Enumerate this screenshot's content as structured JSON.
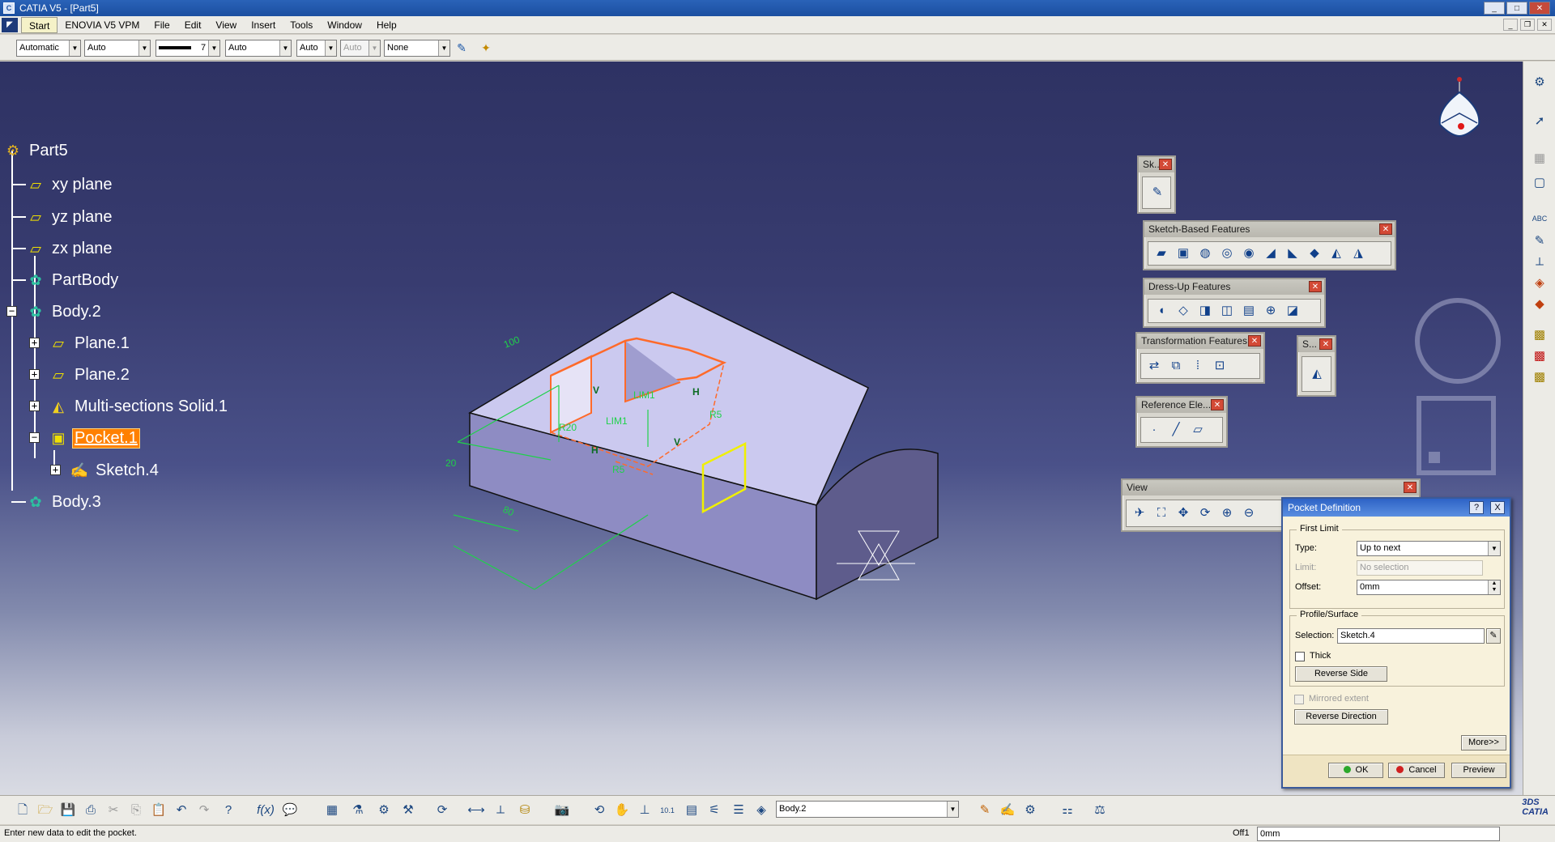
{
  "window": {
    "title": "CATIA V5 - [Part5]"
  },
  "menu": {
    "start": "Start",
    "items": [
      "ENOVIA V5 VPM",
      "File",
      "Edit",
      "View",
      "Insert",
      "Tools",
      "Window",
      "Help"
    ]
  },
  "graphic_properties": {
    "fill_color": "Automatic",
    "transparency": "Auto",
    "line_weight": "7",
    "line_type": "Auto",
    "point_symbol": "Auto",
    "render_style": "Auto",
    "layer": "None"
  },
  "tree": {
    "root": "Part5",
    "items": [
      {
        "label": "xy plane",
        "icon": "plane-icon"
      },
      {
        "label": "yz plane",
        "icon": "plane-icon"
      },
      {
        "label": "zx plane",
        "icon": "plane-icon"
      },
      {
        "label": "PartBody",
        "icon": "body-icon"
      },
      {
        "label": "Body.2",
        "icon": "body-icon"
      },
      {
        "label": "Plane.1",
        "icon": "plane-icon"
      },
      {
        "label": "Plane.2",
        "icon": "plane-icon"
      },
      {
        "label": "Multi-sections Solid.1",
        "icon": "multi-section-solid-icon"
      },
      {
        "label": "Pocket.1",
        "icon": "pocket-icon",
        "selected": true
      },
      {
        "label": "Sketch.4",
        "icon": "sketch-icon"
      },
      {
        "label": "Body.3",
        "icon": "body-icon"
      }
    ]
  },
  "sketch_annotations": {
    "dim_100": "100",
    "dim_20_left": "20",
    "dim_80": "80",
    "dim_r20": "R20",
    "dim_r5_a": "R5",
    "dim_r5_b": "R5",
    "lim1": "LIM1",
    "lim2": "LIM1",
    "h_a": "H",
    "h_b": "H",
    "v_a": "V",
    "v_b": "V"
  },
  "toolbars": {
    "sketcher": {
      "title": "Sk..."
    },
    "sketch_based": {
      "title": "Sketch-Based Features"
    },
    "dress_up": {
      "title": "Dress-Up Features"
    },
    "transformation": {
      "title": "Transformation Features"
    },
    "surface": {
      "title": "S..."
    },
    "reference": {
      "title": "Reference Ele..."
    },
    "view": {
      "title": "View"
    }
  },
  "pocket_dialog": {
    "title": "Pocket Definition",
    "help_btn": "?",
    "close_btn": "X",
    "first_limit": {
      "group": "First Limit",
      "type_label": "Type:",
      "type_value": "Up to next",
      "limit_label": "Limit:",
      "limit_value": "No selection",
      "offset_label": "Offset:",
      "offset_value": "0mm"
    },
    "profile": {
      "group": "Profile/Surface",
      "selection_label": "Selection:",
      "selection_value": "Sketch.4",
      "thick_label": "Thick",
      "reverse_side": "Reverse Side"
    },
    "mirrored_extent": "Mirrored extent",
    "reverse_direction": "Reverse Direction",
    "more": "More>>",
    "ok": "OK",
    "cancel": "Cancel",
    "preview": "Preview"
  },
  "bottom_toolbar": {
    "current_body": "Body.2"
  },
  "status": {
    "message": "Enter new data to edit the pocket.",
    "offset_label": "Off1",
    "offset_value": "0mm"
  },
  "colors": {
    "viewport_top": "#2e3263",
    "viewport_bottom": "#d9dbe3",
    "selection_orange": "#ff8000",
    "dimension_green": "#1fd14a",
    "profile_orange": "#ff6a2a",
    "solid_face": "#cbc9ef"
  }
}
